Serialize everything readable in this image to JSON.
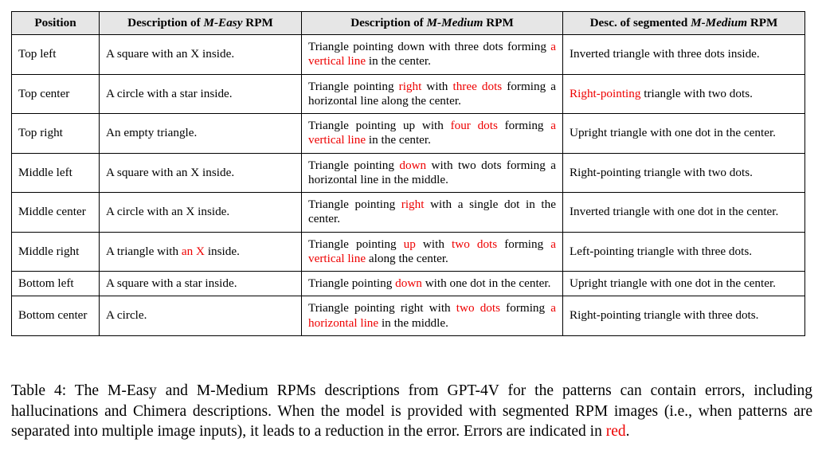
{
  "table": {
    "columns": [
      {
        "prefix": "Position",
        "italic": "",
        "suffix": ""
      },
      {
        "prefix": "Description of ",
        "italic": "M-Easy",
        "suffix": " RPM"
      },
      {
        "prefix": "Description of ",
        "italic": "M-Medium",
        "suffix": " RPM"
      },
      {
        "prefix": "Desc. of segmented ",
        "italic": "M-Medium",
        "suffix": " RPM"
      }
    ],
    "rows": [
      {
        "position": "Top left",
        "easy": [
          {
            "t": "A square with an X inside.",
            "err": false
          }
        ],
        "medium": [
          {
            "t": "Triangle pointing down with three dots forming ",
            "err": false
          },
          {
            "t": "a vertical line",
            "err": true
          },
          {
            "t": " in the center.",
            "err": false
          }
        ],
        "segmented": [
          {
            "t": "Inverted triangle with three dots inside.",
            "err": false
          }
        ]
      },
      {
        "position": "Top center",
        "easy": [
          {
            "t": "A circle with a star inside.",
            "err": false
          }
        ],
        "medium": [
          {
            "t": "Triangle pointing ",
            "err": false
          },
          {
            "t": "right",
            "err": true
          },
          {
            "t": " with ",
            "err": false
          },
          {
            "t": "three dots",
            "err": true
          },
          {
            "t": " forming a horizontal line along the center.",
            "err": false
          }
        ],
        "segmented": [
          {
            "t": "Right-pointing",
            "err": true
          },
          {
            "t": " triangle with two dots.",
            "err": false
          }
        ]
      },
      {
        "position": "Top right",
        "easy": [
          {
            "t": "An empty triangle.",
            "err": false
          }
        ],
        "medium": [
          {
            "t": "Triangle pointing up with ",
            "err": false
          },
          {
            "t": "four dots",
            "err": true
          },
          {
            "t": " form-ing ",
            "err": false
          },
          {
            "t": "a vertical line",
            "err": true
          },
          {
            "t": " in the center.",
            "err": false
          }
        ],
        "segmented": [
          {
            "t": "Upright triangle with one dot in the center.",
            "err": false
          }
        ]
      },
      {
        "position": "Middle left",
        "easy": [
          {
            "t": "A square with an X inside.",
            "err": false
          }
        ],
        "medium": [
          {
            "t": "Triangle pointing ",
            "err": false
          },
          {
            "t": "down",
            "err": true
          },
          {
            "t": " with two dots forming a horizontal line in the middle.",
            "err": false
          }
        ],
        "segmented": [
          {
            "t": "Right-pointing triangle with two dots.",
            "err": false
          }
        ]
      },
      {
        "position": "Middle center",
        "easy": [
          {
            "t": "A circle with an X inside.",
            "err": false
          }
        ],
        "medium": [
          {
            "t": "Triangle pointing ",
            "err": false
          },
          {
            "t": "right",
            "err": true
          },
          {
            "t": " with a single dot in the center.",
            "err": false
          }
        ],
        "segmented": [
          {
            "t": "Inverted triangle with one dot in the center.",
            "err": false
          }
        ]
      },
      {
        "position": "Middle right",
        "easy": [
          {
            "t": "A triangle with ",
            "err": false
          },
          {
            "t": "an X",
            "err": true
          },
          {
            "t": " inside.",
            "err": false
          }
        ],
        "medium": [
          {
            "t": "Triangle pointing ",
            "err": false
          },
          {
            "t": "up",
            "err": true
          },
          {
            "t": " with ",
            "err": false
          },
          {
            "t": "two dots",
            "err": true
          },
          {
            "t": " forming ",
            "err": false
          },
          {
            "t": "a vertical line",
            "err": true
          },
          {
            "t": " along the center.",
            "err": false
          }
        ],
        "segmented": [
          {
            "t": "Left-pointing triangle with three dots.",
            "err": false
          }
        ]
      },
      {
        "position": "Bottom left",
        "easy": [
          {
            "t": "A square with a star inside.",
            "err": false
          }
        ],
        "medium": [
          {
            "t": "Triangle pointing ",
            "err": false
          },
          {
            "t": "down",
            "err": true
          },
          {
            "t": " with one dot in the center.",
            "err": false
          }
        ],
        "segmented": [
          {
            "t": "Upright triangle with one dot in the center.",
            "err": false
          }
        ]
      },
      {
        "position": "Bottom center",
        "easy": [
          {
            "t": "A circle.",
            "err": false
          }
        ],
        "medium": [
          {
            "t": "Triangle pointing right with ",
            "err": false
          },
          {
            "t": "two dots",
            "err": true
          },
          {
            "t": " form-ing ",
            "err": false
          },
          {
            "t": "a horizontal line",
            "err": true
          },
          {
            "t": " in the middle.",
            "err": false
          }
        ],
        "segmented": [
          {
            "t": "Right-pointing triangle with three dots.",
            "err": false
          }
        ]
      }
    ]
  },
  "caption": {
    "label": "Table 4:",
    "parts": [
      {
        "t": " The M-Easy and M-Medium RPMs descriptions from GPT-4V for the patterns can con-tain errors, including hallucinations and Chimera descriptions. When the model is provided with segmented RPM images (i.e., when patterns are separated into multiple image inputs), it leads to a reduction in the error. Errors are indicated in ",
        "err": false
      },
      {
        "t": "red",
        "err": true
      },
      {
        "t": ".",
        "err": false
      }
    ]
  },
  "colors": {
    "error_red": "#ee0000",
    "header_background": "#e6e6e6",
    "border": "#000000",
    "text": "#000000"
  }
}
